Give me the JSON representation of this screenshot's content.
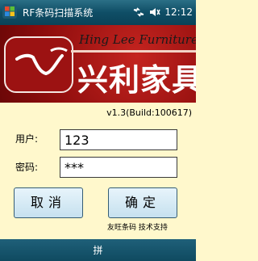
{
  "titlebar": {
    "title": "RF条码扫描系统",
    "clock": "12:12"
  },
  "banner": {
    "brand_en": "Hing Lee Furniture",
    "brand_cn": "兴利家具"
  },
  "version": "v1.3(Build:100617)",
  "form": {
    "user_label": "用户:",
    "user_value": "123",
    "pass_label": "密码:",
    "pass_value": "***"
  },
  "buttons": {
    "cancel": "取消",
    "ok": "确定"
  },
  "support": "友旺条码 技术支持",
  "menubar": {
    "input_label": "拼"
  },
  "colors": {
    "titlebar": "#0f4e66",
    "banner": "#a8161a",
    "background": "#fff8cc",
    "button": "#c6e1ef"
  },
  "icons": [
    "windows-start-icon",
    "network-icon",
    "volume-icon"
  ]
}
